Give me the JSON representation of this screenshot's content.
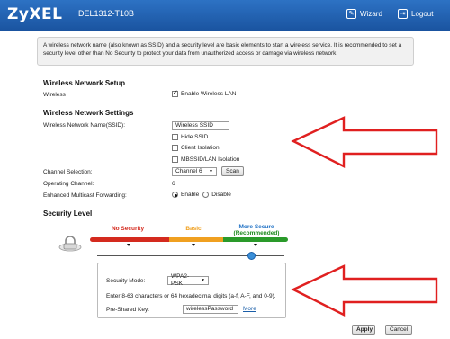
{
  "header": {
    "logo": "ZyXEL",
    "model": "DEL1312-T10B",
    "wizard_label": "Wizard",
    "logout_label": "Logout"
  },
  "info": {
    "text": "A wireless network name (also known as SSID) and a security level are basic elements to start a wireless service. It is recommended to set a security level other than No Security to protect your data from unauthorized access or damage via wireless network."
  },
  "setup": {
    "title": "Wireless Network Setup",
    "wireless_label": "Wireless",
    "enable_wlan_label": "Enable Wireless LAN",
    "enable_wlan_checked": true
  },
  "settings": {
    "title": "Wireless Network Settings",
    "ssid_label": "Wireless Network Name(SSID):",
    "ssid_value": "Wireless SSID",
    "hide_ssid_label": "Hide SSID",
    "client_isolation_label": "Client Isolation",
    "mbssid_label": "MBSSID/LAN Isolation",
    "channel_selection_label": "Channel Selection:",
    "channel_value": "Channel 6",
    "scan_label": "Scan",
    "operating_channel_label": "Operating Channel:",
    "operating_channel_value": "6",
    "multicast_label": "Enhanced Multicast Forwarding:",
    "enable_label": "Enable",
    "disable_label": "Disable"
  },
  "security": {
    "title": "Security Level",
    "levels": [
      "No Security",
      "Basic",
      "More Secure",
      "(Recommended)"
    ],
    "colors": {
      "no_security": "#d42a1e",
      "basic": "#f0a020",
      "more_secure": "#2a9a2a",
      "recommended_text": "#1c8a1c"
    },
    "mode_label": "Security Mode:",
    "mode_value": "WPA2-PSK",
    "hint": "Enter 8-63 characters or 64 hexadecimal digits (a-f, A-F, and 0-9).",
    "psk_label": "Pre-Shared Key:",
    "psk_value": "wirelessPassword",
    "more_label": "More"
  },
  "footer": {
    "apply_label": "Apply",
    "cancel_label": "Cancel"
  },
  "annotation_color": "#e02020"
}
